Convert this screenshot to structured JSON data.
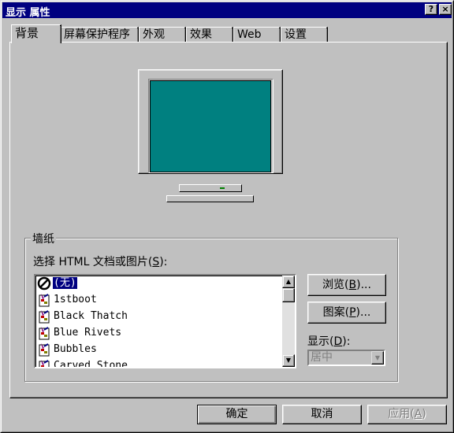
{
  "window": {
    "title": "显示 属性",
    "help_button": "?",
    "close_button": "×"
  },
  "tabs": [
    {
      "label": "背景",
      "active": true
    },
    {
      "label": "屏幕保护程序"
    },
    {
      "label": "外观"
    },
    {
      "label": "效果"
    },
    {
      "label": "Web"
    },
    {
      "label": "设置"
    }
  ],
  "monitor": {
    "screen_color": "#008080"
  },
  "wallpaper": {
    "group_label": "墙纸",
    "select_label_prefix": "选择 HTML 文档或图片(",
    "select_label_key": "S",
    "select_label_suffix": "):",
    "items": [
      {
        "label": "(无)",
        "icon": "none-icon",
        "selected": true
      },
      {
        "label": "1stboot",
        "icon": "paint-file-icon"
      },
      {
        "label": "Black Thatch",
        "icon": "paint-file-icon"
      },
      {
        "label": "Blue Rivets",
        "icon": "paint-file-icon"
      },
      {
        "label": "Bubbles",
        "icon": "paint-file-icon"
      },
      {
        "label": "Carved Stone",
        "icon": "paint-file-icon"
      }
    ],
    "browse_prefix": "浏览(",
    "browse_key": "B",
    "browse_suffix": ")...",
    "pattern_prefix": "图案(",
    "pattern_key": "P",
    "pattern_suffix": ")...",
    "display_prefix": "显示(",
    "display_key": "D",
    "display_suffix": "):",
    "display_value": "居中"
  },
  "footer": {
    "ok": "确定",
    "cancel": "取消",
    "apply_prefix": "应用(",
    "apply_key": "A",
    "apply_suffix": ")"
  }
}
